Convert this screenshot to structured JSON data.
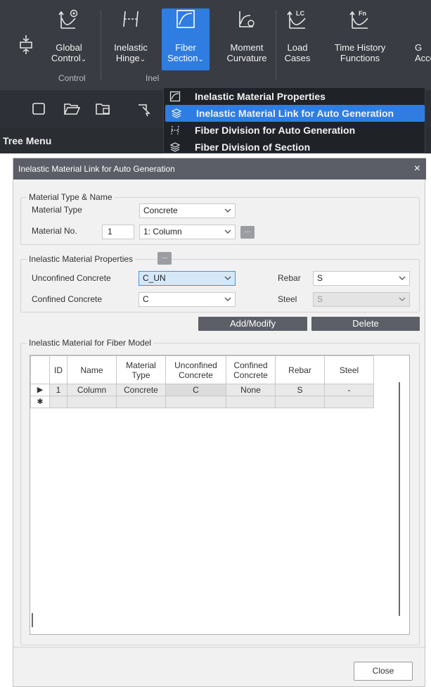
{
  "ribbon": {
    "buttons": [
      {
        "label": "Global\nControl",
        "icon": "global-control-icon"
      },
      {
        "label": "Inelastic\nHinge",
        "icon": "inelastic-hinge-icon"
      },
      {
        "label": "Fiber\nSection",
        "icon": "fiber-section-icon"
      },
      {
        "label": "Moment\nCurvature",
        "icon": "moment-curvature-icon"
      },
      {
        "label": "Load\nCases",
        "icon": "load-cases-icon"
      },
      {
        "label": "Time History\nFunctions",
        "icon": "time-history-functions-icon"
      },
      {
        "label": "G\nAcce",
        "icon": "ground-acceleration-icon"
      }
    ],
    "group_control": "Control",
    "group_inel": "Inel",
    "tree_menu": "Tree Menu"
  },
  "dropdown": {
    "items": [
      {
        "label": "Inelastic Material Properties",
        "icon": "material-properties-icon"
      },
      {
        "label": "Inelastic Material Link for Auto Generation",
        "icon": "material-link-icon"
      },
      {
        "label": "Fiber Division for Auto Generation",
        "icon": "fiber-division-icon"
      },
      {
        "label": "Fiber Division of Section",
        "icon": "fiber-division-section-icon"
      }
    ],
    "highlighted_index": 1
  },
  "dialog": {
    "title": "Inelastic Material Link for Auto Generation",
    "close_glyph": "×",
    "material_group": {
      "legend": "Material Type & Name",
      "type_label": "Material Type",
      "type_value": "Concrete",
      "no_label": "Material No.",
      "no_value": "1",
      "no_select": "1: Column",
      "dots": "..."
    },
    "props_group": {
      "legend": "Inelastic Material Properties",
      "dots": "...",
      "unconfined_label": "Unconfined Concrete",
      "unconfined_value": "C_UN",
      "confined_label": "Confined Concrete",
      "confined_value": "C",
      "rebar_label": "Rebar",
      "rebar_value": "S",
      "steel_label": "Steel",
      "steel_value": "S"
    },
    "add_modify": "Add/Modify",
    "delete": "Delete",
    "fiber_group": {
      "legend": "Inelastic Material for Fiber Model"
    },
    "table": {
      "headers": [
        "ID",
        "Name",
        "Material\nType",
        "Unconfined\nConcrete",
        "Confined\nConcrete",
        "Rebar",
        "Steel"
      ],
      "rows": [
        {
          "marker": "▶",
          "cells": [
            "1",
            "Column",
            "Concrete",
            "C",
            "None",
            "S",
            "-"
          ]
        }
      ],
      "new_row_marker": "✱"
    },
    "close_button": "Close"
  }
}
